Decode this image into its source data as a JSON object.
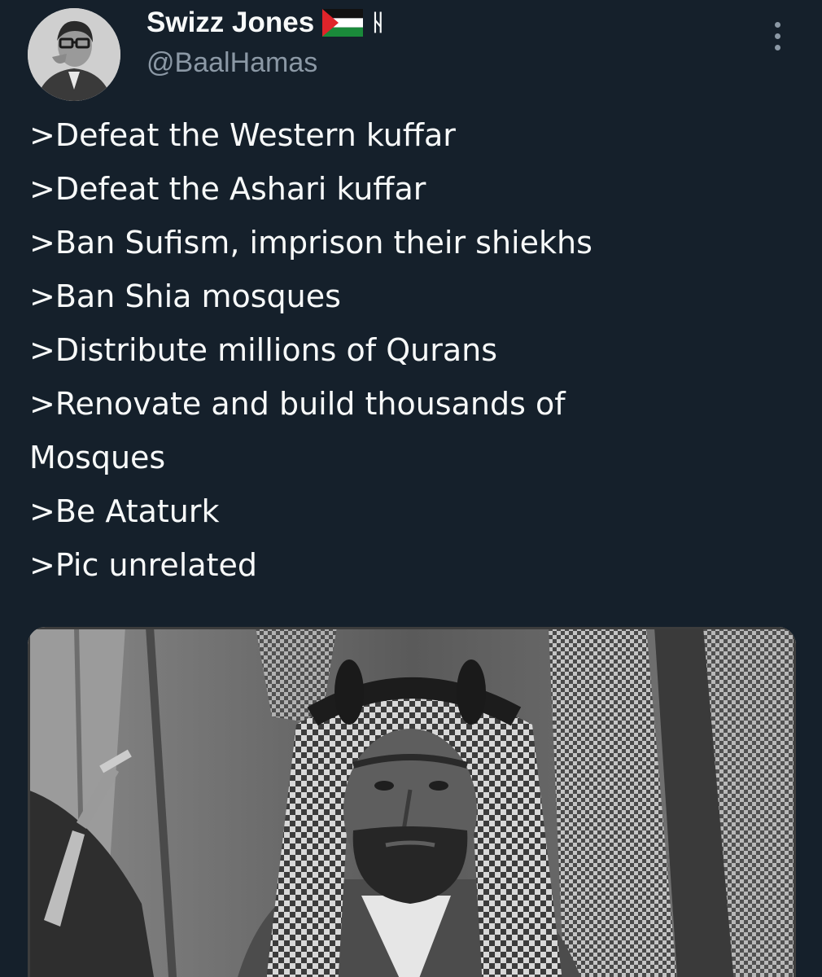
{
  "author": {
    "display_name": "Swizz Jones",
    "flag_icon": "palestine-flag-icon",
    "symbol_icon": "rune-symbol-icon",
    "symbol_glyph": "ᚺ",
    "handle": "@BaalHamas"
  },
  "menu": {
    "more_icon": "more-vertical-icon"
  },
  "tweet": {
    "lines": [
      ">Defeat the Western kuffar",
      ">Defeat the Ashari kuffar",
      ">Ban Sufism, imprison their shiekhs",
      ">Ban Shia mosques",
      ">Distribute millions of Qurans",
      ">Renovate and build thousands of",
      "Mosques",
      ">Be Ataturk",
      ">Pic unrelated"
    ]
  },
  "colors": {
    "background": "#15202b",
    "text": "#f7f9f9",
    "secondary_text": "#8b98a5"
  }
}
